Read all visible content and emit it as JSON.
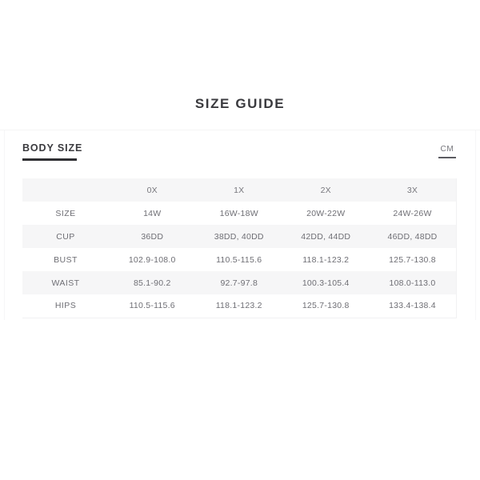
{
  "title": "SIZE GUIDE",
  "section": {
    "label": "BODY SIZE",
    "unit": "CM"
  },
  "table": {
    "corner_header": "",
    "columns": [
      "0X",
      "1X",
      "2X",
      "3X"
    ],
    "rows": [
      {
        "label": "SIZE",
        "values": [
          "14W",
          "16W-18W",
          "20W-22W",
          "24W-26W"
        ]
      },
      {
        "label": "CUP",
        "values": [
          "36DD",
          "38DD, 40DD",
          "42DD, 44DD",
          "46DD, 48DD"
        ]
      },
      {
        "label": "BUST",
        "values": [
          "102.9-108.0",
          "110.5-115.6",
          "118.1-123.2",
          "125.7-130.8"
        ]
      },
      {
        "label": "WAIST",
        "values": [
          "85.1-90.2",
          "92.7-97.8",
          "100.3-105.4",
          "108.0-113.0"
        ]
      },
      {
        "label": "HIPS",
        "values": [
          "110.5-115.6",
          "118.1-123.2",
          "125.7-130.8",
          "133.4-138.4"
        ]
      }
    ]
  },
  "colors": {
    "title": "#3a3a3e",
    "text": "#6e6e74",
    "stripe": "#f6f6f7",
    "accent": "#2f2f33"
  }
}
